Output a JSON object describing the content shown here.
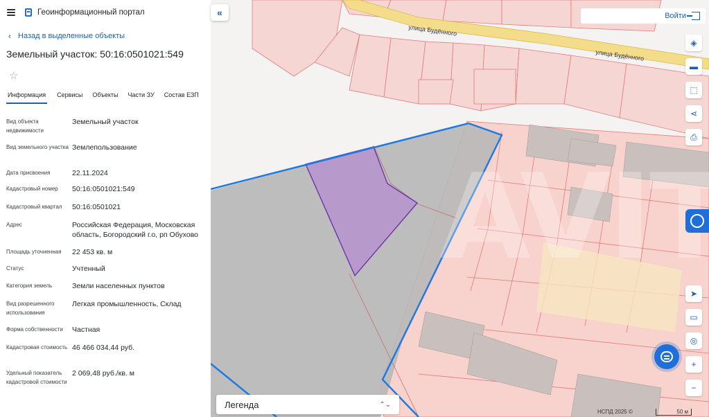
{
  "header": {
    "app_title": "Геоинформационный портал"
  },
  "nav": {
    "back_label": "Назад в выделенные объекты"
  },
  "object": {
    "title": "Земельный участок: 50:16:0501021:549"
  },
  "tabs": [
    {
      "label": "Информация",
      "active": true
    },
    {
      "label": "Сервисы",
      "active": false
    },
    {
      "label": "Объекты",
      "active": false
    },
    {
      "label": "Части ЗУ",
      "active": false
    },
    {
      "label": "Состав ЕЗП",
      "active": false
    }
  ],
  "properties": [
    {
      "label": "Вид объекта недвижимости",
      "value": "Земельный участок"
    },
    {
      "label": "Вид земельного участка",
      "value": "Землепользование"
    },
    {
      "label": "Дата присвоения",
      "value": "22.11.2024"
    },
    {
      "label": "Кадастровый номер",
      "value": "50:16:0501021:549"
    },
    {
      "label": "Кадастровый квартал",
      "value": "50:16:0501021"
    },
    {
      "label": "Адрес",
      "value": "Российская Федерация, Московская область, Богородский г.о, рп Обухово"
    },
    {
      "label": "Площадь уточненная",
      "value": "22 453 кв. м"
    },
    {
      "label": "Статус",
      "value": "Учтенный"
    },
    {
      "label": "Категория земель",
      "value": "Земли населенных пунктов"
    },
    {
      "label": "Вид разрешенного использования",
      "value": "Легкая промышленность, Склад"
    },
    {
      "label": "Форма собственности",
      "value": "Частная"
    },
    {
      "label": "Кадастровая стоимость",
      "value": "46 466 034,44 руб."
    },
    {
      "label": "Удельный показатель кадастровой стоимости",
      "value": "2 069,48 руб./кв. м"
    }
  ],
  "map": {
    "login_label": "Войти",
    "legend_label": "Легенда",
    "copyright": "НСПД 2025 ©",
    "scale_label": "50 м",
    "street_label": "улица Будённого",
    "street_label_2": "улица Будённого",
    "watermark": "AVITO",
    "colors": {
      "parcel_fill": "#f6d6d2",
      "parcel_stroke": "#e07a7a",
      "selected_fill": "#b48ad0",
      "selected_stroke": "#6a35a8",
      "quarter_stroke": "#1f7ae0",
      "gray_zone": "#b9b9b9",
      "road": "#f3dc8a"
    }
  },
  "tools": [
    "layers-icon",
    "ruler-icon",
    "select-area-icon",
    "share-icon",
    "print-icon",
    "navigate-icon",
    "screen-icon",
    "location-icon",
    "zoom-in-icon",
    "zoom-out-icon"
  ]
}
